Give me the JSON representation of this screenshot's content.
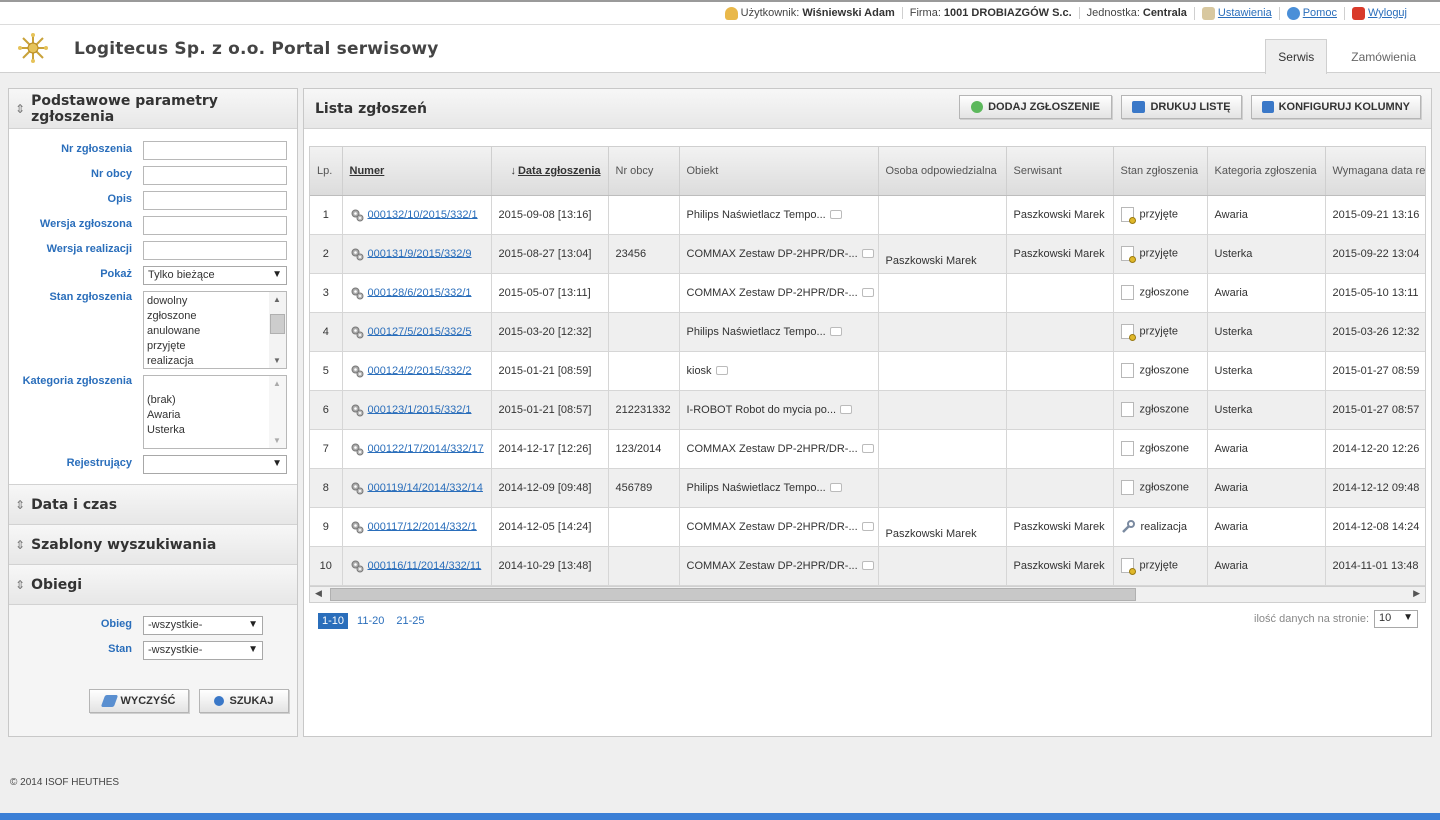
{
  "topbar": {
    "user_label": "Użytkownik:",
    "user_value": "Wiśniewski Adam",
    "company_label": "Firma:",
    "company_value": "1001 DROBIAZGÓW S.c.",
    "unit_label": "Jednostka:",
    "unit_value": "Centrala",
    "settings": "Ustawienia",
    "help": "Pomoc",
    "logout": "Wyloguj"
  },
  "header": {
    "title": "Logitecus Sp. z o.o.  Portal serwisowy",
    "tabs": [
      {
        "label": "Serwis"
      },
      {
        "label": "Zamówienia"
      }
    ]
  },
  "sidebar": {
    "section_title": "Podstawowe parametry zgłoszenia",
    "labels": {
      "nr": "Nr zgłoszenia",
      "nr_obcy": "Nr obcy",
      "opis": "Opis",
      "wersja_zgloszona": "Wersja zgłoszona",
      "wersja_realizacji": "Wersja realizacji",
      "pokaz": "Pokaż",
      "stan": "Stan zgłoszenia",
      "kategoria": "Kategoria zgłoszenia",
      "rejestrujacy": "Rejestrujący"
    },
    "pokaz_value": "Tylko bieżące",
    "stan_options": [
      "dowolny",
      "zgłoszone",
      "anulowane",
      "przyjęte",
      "realizacja"
    ],
    "kategoria_options": [
      "",
      "(brak)",
      "Awaria",
      "Usterka"
    ],
    "rejestrujacy_value": "",
    "collapsed": [
      "Data i czas",
      "Szablony wyszukiwania"
    ],
    "obiegi_title": "Obiegi",
    "obieg_label": "Obieg",
    "obieg_value": "-wszystkie-",
    "obieg_stan_label": "Stan",
    "obieg_stan_value": "-wszystkie-",
    "clear_button": "WYCZYŚĆ",
    "search_button": "SZUKAJ"
  },
  "main": {
    "title": "Lista zgłoszeń",
    "add_button": "DODAJ ZGŁOSZENIE",
    "print_button": "DRUKUJ LISTĘ",
    "config_button": "KONFIGURUJ KOLUMNY",
    "columns": [
      "Lp.",
      "Numer",
      "Data zgłoszenia",
      "Nr obcy",
      "Obiekt",
      "Osoba odpowiedzialna",
      "Serwisant",
      "Stan zgłoszenia",
      "Kategoria zgłoszenia",
      "Wymagana data realizacji"
    ],
    "sort_indicator": "↓",
    "rows": [
      {
        "lp": "1",
        "numer": "000132/10/2015/332/1",
        "data": "2015-09-08 [13:16]",
        "nr_obcy": "",
        "obiekt": "Philips Naświetlacz Tempo...",
        "osoba": "",
        "serwisant": "Paszkowski Marek",
        "stan": "przyjęte",
        "stan_icon": "doc-dot-icon",
        "kategoria": "Awaria",
        "wymagana": "2015-09-21 13:16"
      },
      {
        "lp": "2",
        "numer": "000131/9/2015/332/9",
        "data": "2015-08-27 [13:04]",
        "nr_obcy": "23456",
        "obiekt": "COMMAX Zestaw DP-2HPR/DR-...",
        "osoba": "Paszkowski Marek",
        "serwisant": "Paszkowski Marek",
        "stan": "przyjęte",
        "stan_icon": "doc-dot-icon",
        "kategoria": "Usterka",
        "wymagana": "2015-09-22 13:04"
      },
      {
        "lp": "3",
        "numer": "000128/6/2015/332/1",
        "data": "2015-05-07 [13:11]",
        "nr_obcy": "",
        "obiekt": "COMMAX Zestaw DP-2HPR/DR-...",
        "osoba": "",
        "serwisant": "",
        "stan": "zgłoszone",
        "stan_icon": "doc-icon",
        "kategoria": "Awaria",
        "wymagana": "2015-05-10 13:11"
      },
      {
        "lp": "4",
        "numer": "000127/5/2015/332/5",
        "data": "2015-03-20 [12:32]",
        "nr_obcy": "",
        "obiekt": "Philips Naświetlacz Tempo...",
        "osoba": "",
        "serwisant": "",
        "stan": "przyjęte",
        "stan_icon": "doc-dot-icon",
        "kategoria": "Usterka",
        "wymagana": "2015-03-26 12:32"
      },
      {
        "lp": "5",
        "numer": "000124/2/2015/332/2",
        "data": "2015-01-21 [08:59]",
        "nr_obcy": "",
        "obiekt": "kiosk",
        "osoba": "",
        "serwisant": "",
        "stan": "zgłoszone",
        "stan_icon": "doc-icon",
        "kategoria": "Usterka",
        "wymagana": "2015-01-27 08:59"
      },
      {
        "lp": "6",
        "numer": "000123/1/2015/332/1",
        "data": "2015-01-21 [08:57]",
        "nr_obcy": "212231332",
        "obiekt": "I-ROBOT Robot do mycia po...",
        "osoba": "",
        "serwisant": "",
        "stan": "zgłoszone",
        "stan_icon": "doc-icon",
        "kategoria": "Usterka",
        "wymagana": "2015-01-27 08:57"
      },
      {
        "lp": "7",
        "numer": "000122/17/2014/332/17",
        "data": "2014-12-17 [12:26]",
        "nr_obcy": "123/2014",
        "obiekt": "COMMAX Zestaw DP-2HPR/DR-...",
        "osoba": "",
        "serwisant": "",
        "stan": "zgłoszone",
        "stan_icon": "doc-icon",
        "kategoria": "Awaria",
        "wymagana": "2014-12-20 12:26"
      },
      {
        "lp": "8",
        "numer": "000119/14/2014/332/14",
        "data": "2014-12-09 [09:48]",
        "nr_obcy": "456789",
        "obiekt": "Philips Naświetlacz Tempo...",
        "osoba": "",
        "serwisant": "",
        "stan": "zgłoszone",
        "stan_icon": "doc-icon",
        "kategoria": "Awaria",
        "wymagana": "2014-12-12 09:48"
      },
      {
        "lp": "9",
        "numer": "000117/12/2014/332/1",
        "data": "2014-12-05 [14:24]",
        "nr_obcy": "",
        "obiekt": "COMMAX Zestaw DP-2HPR/DR-...",
        "osoba": "Paszkowski Marek",
        "serwisant": "Paszkowski Marek",
        "stan": "realizacja",
        "stan_icon": "wrench-icon",
        "kategoria": "Awaria",
        "wymagana": "2014-12-08 14:24"
      },
      {
        "lp": "10",
        "numer": "000116/11/2014/332/11",
        "data": "2014-10-29 [13:48]",
        "nr_obcy": "",
        "obiekt": "COMMAX Zestaw DP-2HPR/DR-...",
        "osoba": "",
        "serwisant": "Paszkowski Marek",
        "stan": "przyjęte",
        "stan_icon": "doc-dot-icon",
        "kategoria": "Awaria",
        "wymagana": "2014-11-01 13:48"
      }
    ],
    "pages": [
      "1-10",
      "11-20",
      "21-25"
    ],
    "current_page": "1-10",
    "per_page_label": "ilość danych na stronie:",
    "per_page_value": "10"
  },
  "footer": "© 2014 ISOF HEUTHES",
  "colors": {
    "link": "#2a6ebb",
    "accent_bar": "#3b7fd6",
    "row_alt": "#efefef"
  }
}
